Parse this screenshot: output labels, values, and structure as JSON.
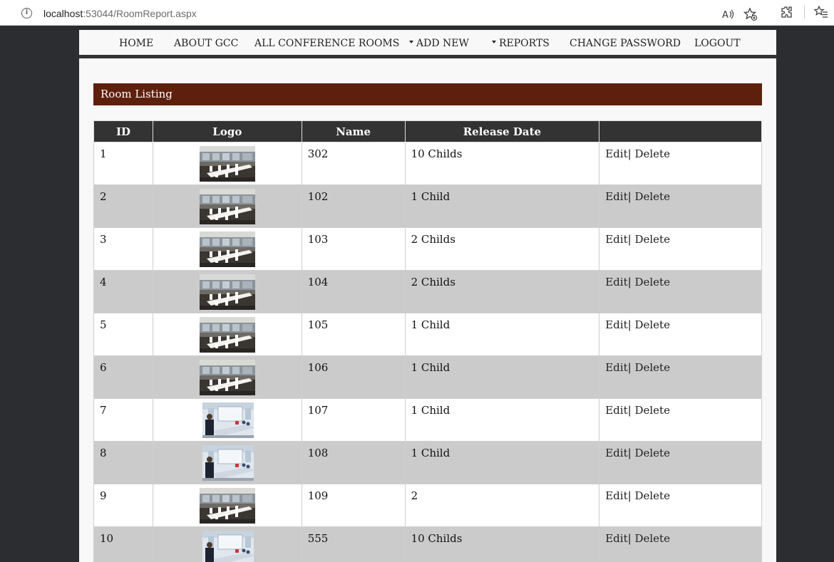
{
  "browser": {
    "url_host": "localhost",
    "url_path": ":53044/RoomReport.aspx",
    "icons": [
      "info-icon",
      "read-aloud-icon",
      "favorite-add-icon",
      "extensions-icon",
      "favorites-icon"
    ]
  },
  "nav": {
    "items": [
      {
        "label": "HOME"
      },
      {
        "label": "ABOUT GCC"
      },
      {
        "label": "ALL CONFERENCE ROOMS"
      },
      {
        "label": "ADD NEW"
      },
      {
        "label": "REPORTS"
      },
      {
        "label": "CHANGE PASSWORD"
      },
      {
        "label": "LOGOUT"
      }
    ]
  },
  "section_title": "Room Listing",
  "table": {
    "headers": [
      "ID",
      "Logo",
      "Name",
      "Release Date",
      ""
    ],
    "edit_label": "Edit",
    "separator": "|",
    "delete_label": "Delete",
    "rows": [
      {
        "id": "1",
        "logo": "room-photo-a",
        "name": "302",
        "release": "10 Childs"
      },
      {
        "id": "2",
        "logo": "room-photo-a",
        "name": "102",
        "release": "1 Child"
      },
      {
        "id": "3",
        "logo": "room-photo-a",
        "name": "103",
        "release": "2 Childs"
      },
      {
        "id": "4",
        "logo": "room-photo-a",
        "name": "104",
        "release": "2 Childs"
      },
      {
        "id": "5",
        "logo": "room-photo-a",
        "name": "105",
        "release": "1 Child"
      },
      {
        "id": "6",
        "logo": "room-photo-a",
        "name": "106",
        "release": "1 Child"
      },
      {
        "id": "7",
        "logo": "room-photo-b",
        "name": "107",
        "release": "1 Child"
      },
      {
        "id": "8",
        "logo": "room-photo-b",
        "name": "108",
        "release": "1 Child"
      },
      {
        "id": "9",
        "logo": "room-photo-a",
        "name": "109",
        "release": "2"
      },
      {
        "id": "10",
        "logo": "room-photo-b",
        "name": "555",
        "release": "10 Childs"
      }
    ]
  },
  "colors": {
    "title_bar": "#5e200d",
    "header_bg": "#333333",
    "alt_row": "#cbcbcb"
  }
}
